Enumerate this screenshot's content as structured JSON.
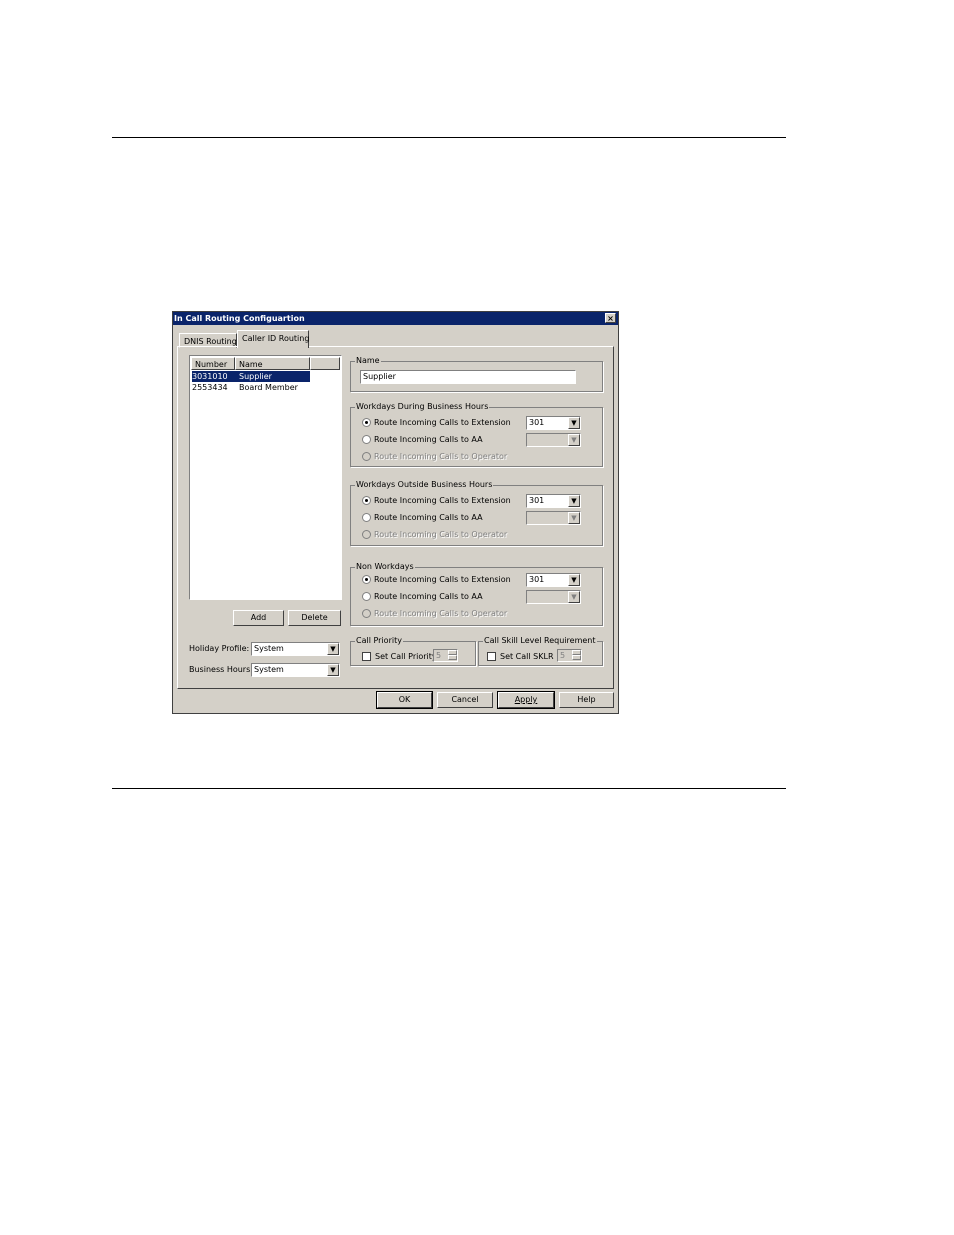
{
  "dialog": {
    "title": "In Call Routing Configuartion",
    "close_glyph": "×",
    "tabs": [
      "DNIS Routing",
      "Caller ID Routing"
    ]
  },
  "list": {
    "columns": [
      "Number",
      "Name"
    ],
    "rows": [
      {
        "number": "3031010",
        "name": "Supplier"
      },
      {
        "number": "2553434",
        "name": "Board Member"
      }
    ],
    "add_label": "Add",
    "delete_label": "Delete"
  },
  "profiles": {
    "holiday_label": "Holiday Profile:",
    "holiday_value": "System",
    "business_label": "Business Hours:",
    "business_value": "System"
  },
  "name_group": {
    "title": "Name",
    "value": "Supplier"
  },
  "groups": [
    {
      "title": "Workdays During Business Hours",
      "opt_extension": "Route Incoming Calls to Extension",
      "opt_aa": "Route Incoming Calls to AA",
      "opt_operator": "Route Incoming Calls to Operator",
      "extension_value": "301"
    },
    {
      "title": "Workdays Outside Business Hours",
      "opt_extension": "Route Incoming Calls to Extension",
      "opt_aa": "Route Incoming Calls to AA",
      "opt_operator": "Route Incoming Calls to Operator",
      "extension_value": "301"
    },
    {
      "title": "Non Workdays",
      "opt_extension": "Route Incoming Calls to Extension",
      "opt_aa": "Route Incoming Calls to AA",
      "opt_operator": "Route Incoming Calls to Operator",
      "extension_value": "301"
    }
  ],
  "call_priority": {
    "title": "Call Priority",
    "checkbox_label": "Set Call Priority",
    "value": "5"
  },
  "skill_level": {
    "title": "Call Skill Level Requirement",
    "checkbox_label": "Set Call SKLR",
    "value": "5"
  },
  "buttons": {
    "ok": "OK",
    "cancel": "Cancel",
    "apply": "Apply",
    "help": "Help"
  },
  "icons": {
    "dropdown": "▼"
  }
}
